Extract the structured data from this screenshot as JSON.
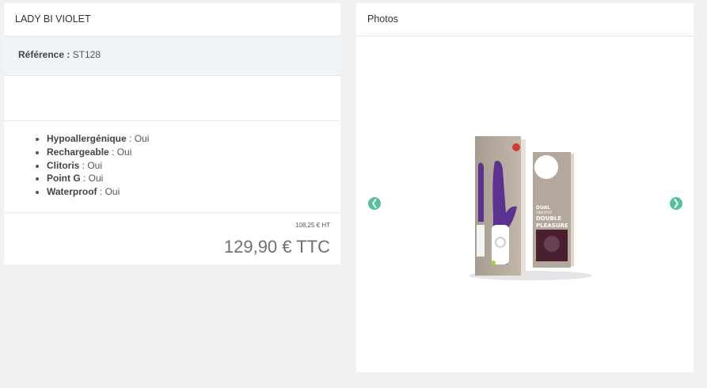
{
  "product": {
    "title": "LADY BI VIOLET",
    "reference_label": "Référence :",
    "reference_value": "ST128",
    "features": [
      {
        "name": "Hypoallergénique",
        "value": " : Oui"
      },
      {
        "name": "Rechargeable",
        "value": " : Oui"
      },
      {
        "name": "Clitoris",
        "value": " : Oui"
      },
      {
        "name": "Point G",
        "value": " : Oui"
      },
      {
        "name": "Waterproof",
        "value": " : Oui"
      }
    ],
    "price_ht": "108,25 € HT",
    "price_ttc": "129,90 € TTC"
  },
  "photos": {
    "title": "Photos",
    "prev_icon": "chevron-left-icon",
    "next_icon": "chevron-right-icon",
    "box_text": {
      "line1": "DUAL",
      "line2": "VIBRATOR",
      "line3": "DOUBLE",
      "line4": "PLEASURE"
    }
  },
  "colors": {
    "accent": "#55bfa1",
    "toy_purple": "#5b3290",
    "box_beige": "#b3a89b"
  }
}
